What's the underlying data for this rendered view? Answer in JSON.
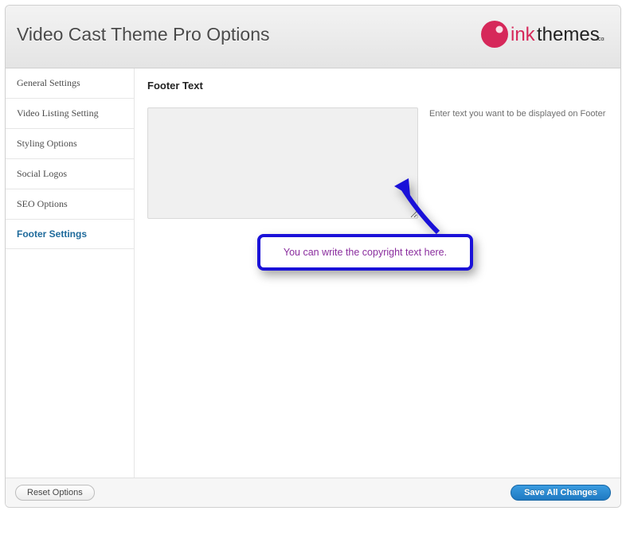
{
  "header": {
    "title": "Video Cast Theme Pro Options",
    "brand_prefix": "ink",
    "brand_suffix": "themes",
    "brand_tld": ".com"
  },
  "sidebar": {
    "items": [
      {
        "label": "General Settings",
        "active": false
      },
      {
        "label": "Video Listing Setting",
        "active": false
      },
      {
        "label": "Styling Options",
        "active": false
      },
      {
        "label": "Social Logos",
        "active": false
      },
      {
        "label": "SEO Options",
        "active": false
      },
      {
        "label": "Footer Settings",
        "active": true
      }
    ]
  },
  "content": {
    "section_title": "Footer Text",
    "textarea_value": "",
    "help_text": "Enter text you want to be displayed on Footer"
  },
  "annotation": {
    "text": "You can write the copyright text here."
  },
  "footer": {
    "reset_label": "Reset Options",
    "save_label": "Save All Changes"
  }
}
